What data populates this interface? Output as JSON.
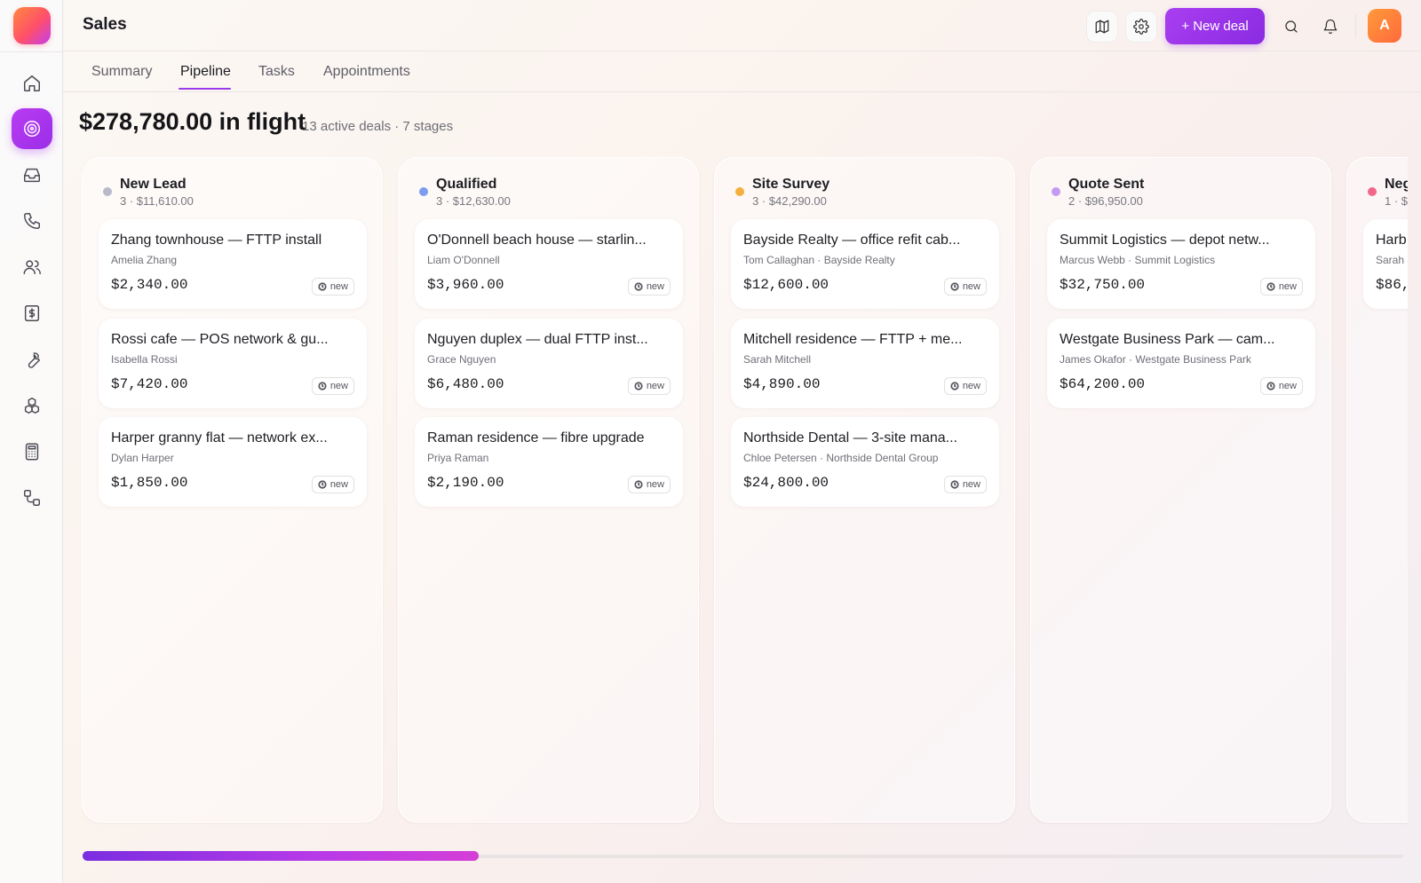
{
  "app": {
    "title": "Sales",
    "avatar_initial": "A"
  },
  "header": {
    "new_deal_label": "+ New deal"
  },
  "tabs": [
    {
      "label": "Summary",
      "active": false
    },
    {
      "label": "Pipeline",
      "active": true
    },
    {
      "label": "Tasks",
      "active": false
    },
    {
      "label": "Appointments",
      "active": false
    }
  ],
  "summary": {
    "amount": "$278,780.00 in flight",
    "meta": "13 active deals · 7 stages"
  },
  "columns": [
    {
      "title": "New Lead",
      "sub": "3 · $11,610.00",
      "dot_color": "#b9b9c9",
      "cards": [
        {
          "title": "Zhang townhouse — FTTP install",
          "sub": "Amelia Zhang",
          "amount": "$2,340.00",
          "badge": "new"
        },
        {
          "title": "Rossi cafe — POS network & gu...",
          "sub": "Isabella Rossi",
          "amount": "$7,420.00",
          "badge": "new"
        },
        {
          "title": "Harper granny flat — network ex...",
          "sub": "Dylan Harper",
          "amount": "$1,850.00",
          "badge": "new"
        }
      ]
    },
    {
      "title": "Qualified",
      "sub": "3 · $12,630.00",
      "dot_color": "#7c9cf0",
      "cards": [
        {
          "title": "O'Donnell beach house — starlin...",
          "sub": "Liam O'Donnell",
          "amount": "$3,960.00",
          "badge": "new"
        },
        {
          "title": "Nguyen duplex — dual FTTP inst...",
          "sub": "Grace Nguyen",
          "amount": "$6,480.00",
          "badge": "new"
        },
        {
          "title": "Raman residence — fibre upgrade",
          "sub": "Priya Raman",
          "amount": "$2,190.00",
          "badge": "new"
        }
      ]
    },
    {
      "title": "Site Survey",
      "sub": "3 · $42,290.00",
      "dot_color": "#f4b03c",
      "cards": [
        {
          "title": "Bayside Realty — office refit cab...",
          "sub": "Tom Callaghan · Bayside Realty",
          "amount": "$12,600.00",
          "badge": "new"
        },
        {
          "title": "Mitchell residence — FTTP + me...",
          "sub": "Sarah Mitchell",
          "amount": "$4,890.00",
          "badge": "new"
        },
        {
          "title": "Northside Dental — 3-site mana...",
          "sub": "Chloe Petersen · Northside Dental Group",
          "amount": "$24,800.00",
          "badge": "new"
        }
      ]
    },
    {
      "title": "Quote Sent",
      "sub": "2 · $96,950.00",
      "dot_color": "#c49af2",
      "cards": [
        {
          "title": "Summit Logistics — depot netw...",
          "sub": "Marcus Webb · Summit Logistics",
          "amount": "$32,750.00",
          "badge": "new"
        },
        {
          "title": "Westgate Business Park — cam...",
          "sub": "James Okafor · Westgate Business Park",
          "amount": "$64,200.00",
          "badge": "new"
        }
      ]
    },
    {
      "title": "Neg",
      "sub": "1 · $8",
      "dot_color": "#f2668c",
      "cards": [
        {
          "title": "Harb",
          "sub": "Sarah",
          "amount": "$86,",
          "badge": ""
        }
      ]
    }
  ],
  "scrollbar": {
    "position": 0.3
  },
  "colors": {
    "accent": "#9b3ae8",
    "avatar": "#ff7a3a"
  }
}
